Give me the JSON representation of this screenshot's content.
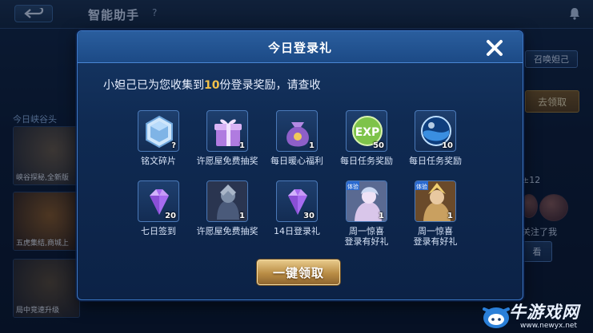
{
  "app": {
    "title": "智能助手",
    "help_icon": "?",
    "back_icon": "back-arrow-icon",
    "bell_icon": "bell-icon"
  },
  "background": {
    "left_heading": "今日峡谷头",
    "cards": [
      {
        "caption": "峡谷探秘,全新版"
      },
      {
        "caption": "五虎集结,商城上"
      },
      {
        "caption": "局中竞速升级"
      }
    ],
    "right": {
      "summon_button": "召唤妲己",
      "claim_button": "去领取",
      "count_text": "±12",
      "notice_text": "关注了我",
      "view_button": "看"
    }
  },
  "modal": {
    "title": "今日登录礼",
    "close_label": "✕",
    "message_prefix": "小妲己已为您收集到",
    "message_count": "10",
    "message_suffix": "份登录奖励，请查收",
    "rewards": [
      {
        "label": "铭文碎片",
        "qty": "?",
        "icon": "inscription-shard-icon",
        "color": "#7fb4e6"
      },
      {
        "label": "许愿屋免费抽奖",
        "qty": "1",
        "icon": "gift-box-icon",
        "color": "#b07be0"
      },
      {
        "label": "每日暖心福利",
        "qty": "1",
        "icon": "treasure-bag-icon",
        "color": "#8e5fc8"
      },
      {
        "label": "每日任务奖励",
        "qty": "50",
        "icon": "exp-icon",
        "color": "#7ec34a"
      },
      {
        "label": "每日任务奖励",
        "qty": "10",
        "icon": "blue-orb-icon",
        "color": "#3a8ee0"
      },
      {
        "label": "七日签到",
        "qty": "20",
        "icon": "purple-gem-icon",
        "color": "#a66bf0"
      },
      {
        "label": "许愿屋免费抽奖",
        "qty": "1",
        "icon": "hero-portrait-icon",
        "color": "#4a5a7a"
      },
      {
        "label": "14日登录礼",
        "qty": "30",
        "icon": "purple-gem-icon",
        "color": "#a66bf0"
      },
      {
        "label": "周一惊喜",
        "label2": "登录有好礼",
        "qty": "1",
        "badge": "体验",
        "icon": "skin-trial-card-icon",
        "color": "#d9c6ea"
      },
      {
        "label": "周一惊喜",
        "label2": "登录有好礼",
        "qty": "1",
        "badge": "体验",
        "icon": "hero-trial-card-icon",
        "color": "#c9a060"
      }
    ],
    "claim_all_button": "一键领取"
  },
  "watermark": {
    "text": "牛游戏网",
    "url": "www.newyx.net"
  }
}
